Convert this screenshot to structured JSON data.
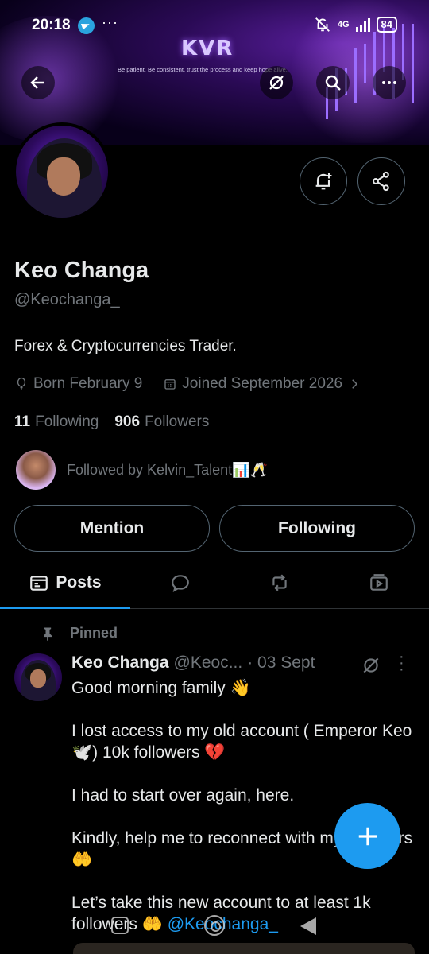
{
  "status_bar": {
    "time": "20:18",
    "more": "···",
    "network": "4G",
    "battery": "84"
  },
  "banner": {
    "logo": "KVR",
    "tagline": "Be patient, Be consistent, trust the process and keep hope alive."
  },
  "header": {
    "icons": [
      "back-arrow-icon",
      "grok-icon",
      "search-icon",
      "more-icon"
    ]
  },
  "profile": {
    "name": "Keo Changa",
    "handle": "@Keochanga_",
    "bio": "Forex & Cryptocurrencies Trader.",
    "born": "Born February 9",
    "joined": "Joined September 2026",
    "following_count": "11",
    "following_label": "Following",
    "followers_count": "906",
    "followers_label": "Followers",
    "followed_by": "Followed by Kelvin_Talent📊🥂"
  },
  "actions": {
    "mention": "Mention",
    "following": "Following"
  },
  "tabs": [
    {
      "label": "Posts",
      "icon": "posts-icon",
      "active": true
    },
    {
      "label": "",
      "icon": "reply-icon"
    },
    {
      "label": "",
      "icon": "repost-icon"
    },
    {
      "label": "",
      "icon": "media-icon"
    }
  ],
  "post": {
    "pinned_label": "Pinned",
    "author_name": "Keo Changa",
    "author_handle": "@Keoc...",
    "date": "· 03 Sept",
    "lines": [
      "Good morning family 👋",
      "I lost access to my old account ( Emperor Keo 🕊️) 10k followers 💔",
      "I had to start over again, here.",
      "Kindly, help me to reconnect with my followers 🤲"
    ],
    "last_line_text": "Let’s take this new account to at least 1k followers 🤲",
    "mention": "@Keochanga_"
  },
  "colors": {
    "accent": "#1d9bf0",
    "muted": "#71767b",
    "text": "#e7e9ea",
    "border": "#536471"
  }
}
